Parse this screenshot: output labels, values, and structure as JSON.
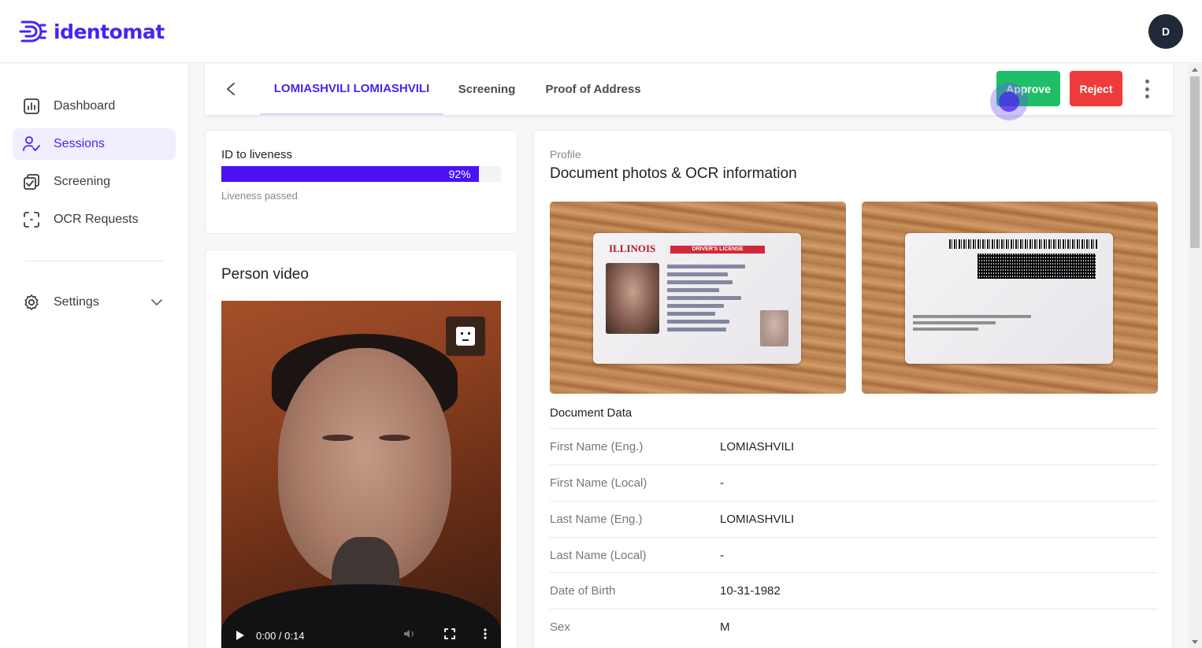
{
  "app": {
    "logo_text": "identomat",
    "brand_color": "#4a23f2",
    "avatar_initial": "D"
  },
  "sidebar": {
    "items": [
      {
        "label": "Dashboard",
        "icon": "bar-chart-icon"
      },
      {
        "label": "Sessions",
        "icon": "users-check-icon",
        "active": true
      },
      {
        "label": "Screening",
        "icon": "copy-check-icon"
      },
      {
        "label": "OCR Requests",
        "icon": "scan-frame-icon"
      }
    ],
    "settings": {
      "label": "Settings",
      "icon": "gear-icon"
    }
  },
  "tabs": {
    "items": [
      {
        "label": "LOMIASHVILI LOMIASHVILI",
        "active": true
      },
      {
        "label": "Screening"
      },
      {
        "label": "Proof of Address"
      }
    ],
    "approve_label": "Approve",
    "reject_label": "Reject",
    "approve_color": "#1fbf6a",
    "reject_color": "#ef3b3b"
  },
  "liveness": {
    "title": "ID to liveness",
    "percent": 92,
    "percent_label": "92%",
    "status": "Liveness passed"
  },
  "video": {
    "title": "Person video",
    "time": "0:00 / 0:14"
  },
  "profile": {
    "kicker": "Profile",
    "title": "Document photos & OCR information",
    "document_data_title": "Document Data",
    "front_card": {
      "state": "ILLINOIS",
      "tag": "DRIVER'S LICENSE"
    },
    "fields": [
      {
        "label": "First Name (Eng.)",
        "value": "LOMIASHVILI"
      },
      {
        "label": "First Name (Local)",
        "value": "-"
      },
      {
        "label": "Last Name (Eng.)",
        "value": "LOMIASHVILI"
      },
      {
        "label": "Last Name (Local)",
        "value": "-"
      },
      {
        "label": "Date of Birth",
        "value": "10-31-1982"
      },
      {
        "label": "Sex",
        "value": "M"
      }
    ]
  }
}
